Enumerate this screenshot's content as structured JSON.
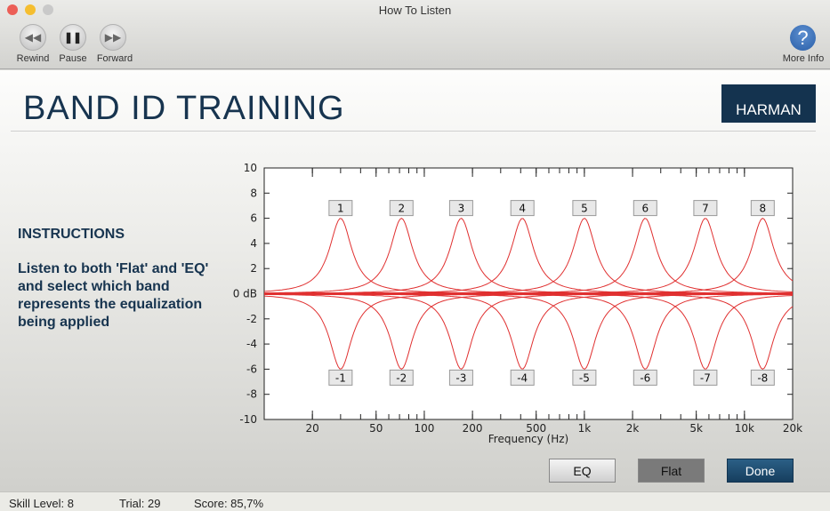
{
  "window": {
    "title": "How To Listen"
  },
  "toolbar": {
    "rewind": "Rewind",
    "pause": "Pause",
    "forward": "Forward",
    "more_info": "More Info"
  },
  "header": {
    "title": "BAND ID TRAINING",
    "logo": "HARMAN"
  },
  "instructions": {
    "heading": "INSTRUCTIONS",
    "text": "Listen to both 'Flat' and 'EQ' and select which band represents the equalization being applied"
  },
  "buttons": {
    "eq": "EQ",
    "flat": "Flat",
    "done": "Done"
  },
  "status": {
    "skill": "Skill Level: 8",
    "trial": "Trial: 29",
    "score": "Score: 85,7%"
  },
  "chart_data": {
    "type": "line",
    "xlabel": "Frequency (Hz)",
    "xscale": "log",
    "xlim": [
      10,
      20000
    ],
    "ylim": [
      -10,
      10
    ],
    "x_ticks": [
      {
        "v": 20,
        "l": "20"
      },
      {
        "v": 50,
        "l": "50"
      },
      {
        "v": 100,
        "l": "100"
      },
      {
        "v": 200,
        "l": "200"
      },
      {
        "v": 500,
        "l": "500"
      },
      {
        "v": 1000,
        "l": "1k"
      },
      {
        "v": 2000,
        "l": "2k"
      },
      {
        "v": 5000,
        "l": "5k"
      },
      {
        "v": 10000,
        "l": "10k"
      },
      {
        "v": 20000,
        "l": "20k"
      }
    ],
    "y_ticks": [
      {
        "v": 10,
        "l": "10"
      },
      {
        "v": 8,
        "l": "8"
      },
      {
        "v": 6,
        "l": "6"
      },
      {
        "v": 4,
        "l": "4"
      },
      {
        "v": 2,
        "l": "2"
      },
      {
        "v": 0,
        "l": "0 dB"
      },
      {
        "v": -2,
        "l": "-2"
      },
      {
        "v": -4,
        "l": "-4"
      },
      {
        "v": -6,
        "l": "-6"
      },
      {
        "v": -8,
        "l": "-8"
      },
      {
        "v": -10,
        "l": "-10"
      }
    ],
    "gain_db": 6,
    "bands": [
      {
        "center_hz": 30,
        "boost": "1",
        "cut": "-1"
      },
      {
        "center_hz": 72,
        "boost": "2",
        "cut": "-2"
      },
      {
        "center_hz": 170,
        "boost": "3",
        "cut": "-3"
      },
      {
        "center_hz": 410,
        "boost": "4",
        "cut": "-4"
      },
      {
        "center_hz": 1000,
        "boost": "5",
        "cut": "-5"
      },
      {
        "center_hz": 2400,
        "boost": "6",
        "cut": "-6"
      },
      {
        "center_hz": 5700,
        "boost": "7",
        "cut": "-7"
      },
      {
        "center_hz": 13000,
        "boost": "8",
        "cut": "-8"
      }
    ],
    "line_color": "#e03030"
  }
}
